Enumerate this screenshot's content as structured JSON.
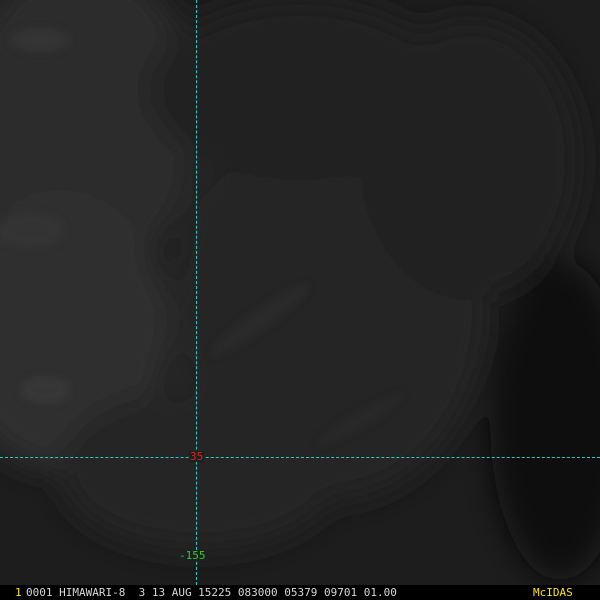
{
  "grid": {
    "latitude_label": "35",
    "longitude_label": "-155",
    "line_color": "#2ec8c8",
    "latitude_label_color": "#e02020",
    "longitude_label_color": "#28d228"
  },
  "status_bar": {
    "frame_number": "1",
    "text": "0001 HIMAWARI-8  3 13 AUG 15225 083000 05379 09701 01.00",
    "brand": "McIDAS",
    "text_color": "#d8d8d8",
    "highlight_color": "#ffe600"
  }
}
